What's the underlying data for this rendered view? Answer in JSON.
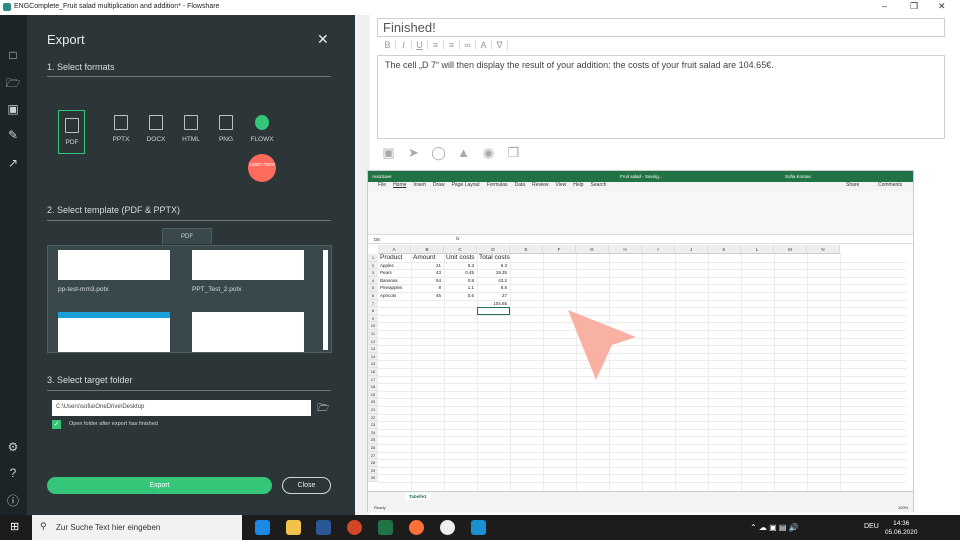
{
  "window": {
    "title": "ENGComplete_Fruit salad multiplication and addition* - Flowshare"
  },
  "export": {
    "title": "Export",
    "sec1": "1. Select formats",
    "formats": [
      "PDF",
      "PPTX",
      "DOCX",
      "HTML",
      "PNG",
      "FLOWX"
    ],
    "learn_more": "Learn more",
    "sec2": "2. Select template (PDF & PPTX)",
    "template_tab": "PDF",
    "templates": [
      "pp-test-mm3.potx",
      "PPT_Test_2.potx"
    ],
    "sec3": "3. Select target folder",
    "folder": "C:\\Users\\sofia\\OneDrive\\Desktop",
    "open_folder": "Open folder after export has finished",
    "export_btn": "Export",
    "close_btn": "Close"
  },
  "step": {
    "title": "Finished!",
    "text": "The cell „D 7“ will then display the result of your addition: the costs of your fruit salad are 104.65€."
  },
  "excel": {
    "title": "Fruit salad - Saving...",
    "user": "Sofia Kornas",
    "autosave": "AutoSave",
    "menu": [
      "File",
      "Home",
      "Insert",
      "Draw",
      "Page Layout",
      "Formulas",
      "Data",
      "Review",
      "View",
      "Help",
      "Search"
    ],
    "share": "Share",
    "comments": "Comments",
    "namebox": "D8",
    "sheet": "Tabelle1",
    "status": "Ready",
    "zoom": "100%",
    "columns": [
      "A",
      "B",
      "C",
      "D",
      "E",
      "F",
      "G",
      "H",
      "I",
      "J",
      "K",
      "L",
      "M",
      "N"
    ],
    "header_row": [
      "Product",
      "Amount",
      "Unit costs",
      "Total costs"
    ],
    "rows": [
      [
        "Apples",
        "21",
        "0.3",
        "6.3"
      ],
      [
        "Pears",
        "43",
        "0.45",
        "19.35"
      ],
      [
        "Bananas",
        "54",
        "0.8",
        "43.2"
      ],
      [
        "Pineapples",
        "8",
        "1.1",
        "8.8"
      ],
      [
        "Apricots",
        "45",
        "0.6",
        "27"
      ]
    ],
    "total": "104.65"
  },
  "taskbar": {
    "search": "Zur Suche Text hier eingeben",
    "lang": "DEU",
    "time": "14:36",
    "date": "05.06.2020"
  }
}
